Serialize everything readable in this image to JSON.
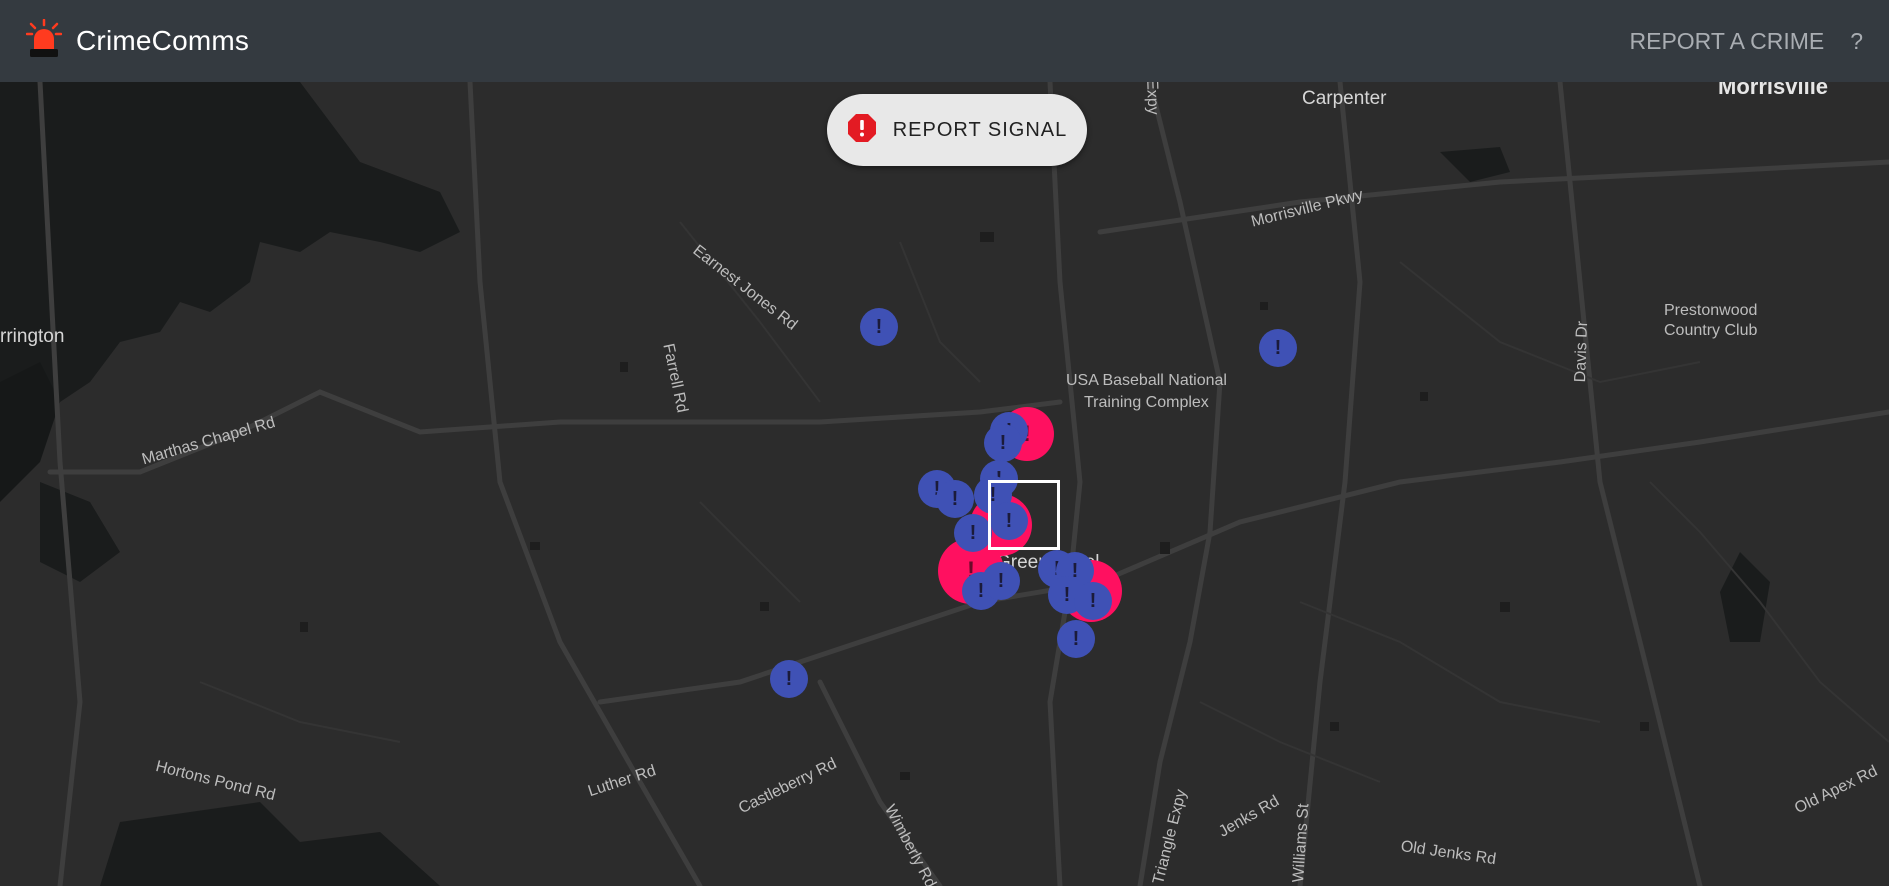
{
  "header": {
    "app_title": "CrimeComms",
    "report_crime_label": "REPORT A CRIME",
    "help_label": "?",
    "logo_icon": "siren-icon",
    "logo_color": "#ff3b1f"
  },
  "map": {
    "signal_button_label": "REPORT SIGNAL",
    "signal_icon": "alert-octagon-icon",
    "signal_icon_color": "#e31b23",
    "marker_colors": {
      "incident": "#3f51b5",
      "hotspot": "#ff1060"
    },
    "labels": {
      "morrisville": "Morrisville",
      "carpenter": "Carpenter",
      "morrisville_pkwy": "Morrisville Pkwy",
      "expy_top": "Expy",
      "earnest_jones": "Earnest Jones Rd",
      "farrell": "Farrell Rd",
      "usa_baseball_1": "USA Baseball National",
      "usa_baseball_2": "Training Complex",
      "prestonwood_1": "Prestonwood",
      "prestonwood_2": "Country Club",
      "davis_dr": "Davis Dr",
      "arrington": "rrington",
      "martha_chapel": "Marthas Chapel Rd",
      "green_level": "Green Level",
      "hortons_pond": "Hortons Pond Rd",
      "luther": "Luther Rd",
      "castleberry": "Castleberry Rd",
      "wimberly": "Wimberly Rd",
      "triangle_expy": "Triangle Expy",
      "jenks": "Jenks Rd",
      "williams": "Williams St",
      "old_jenks": "Old Jenks Rd",
      "old_apex": "Old Apex Rd"
    }
  }
}
